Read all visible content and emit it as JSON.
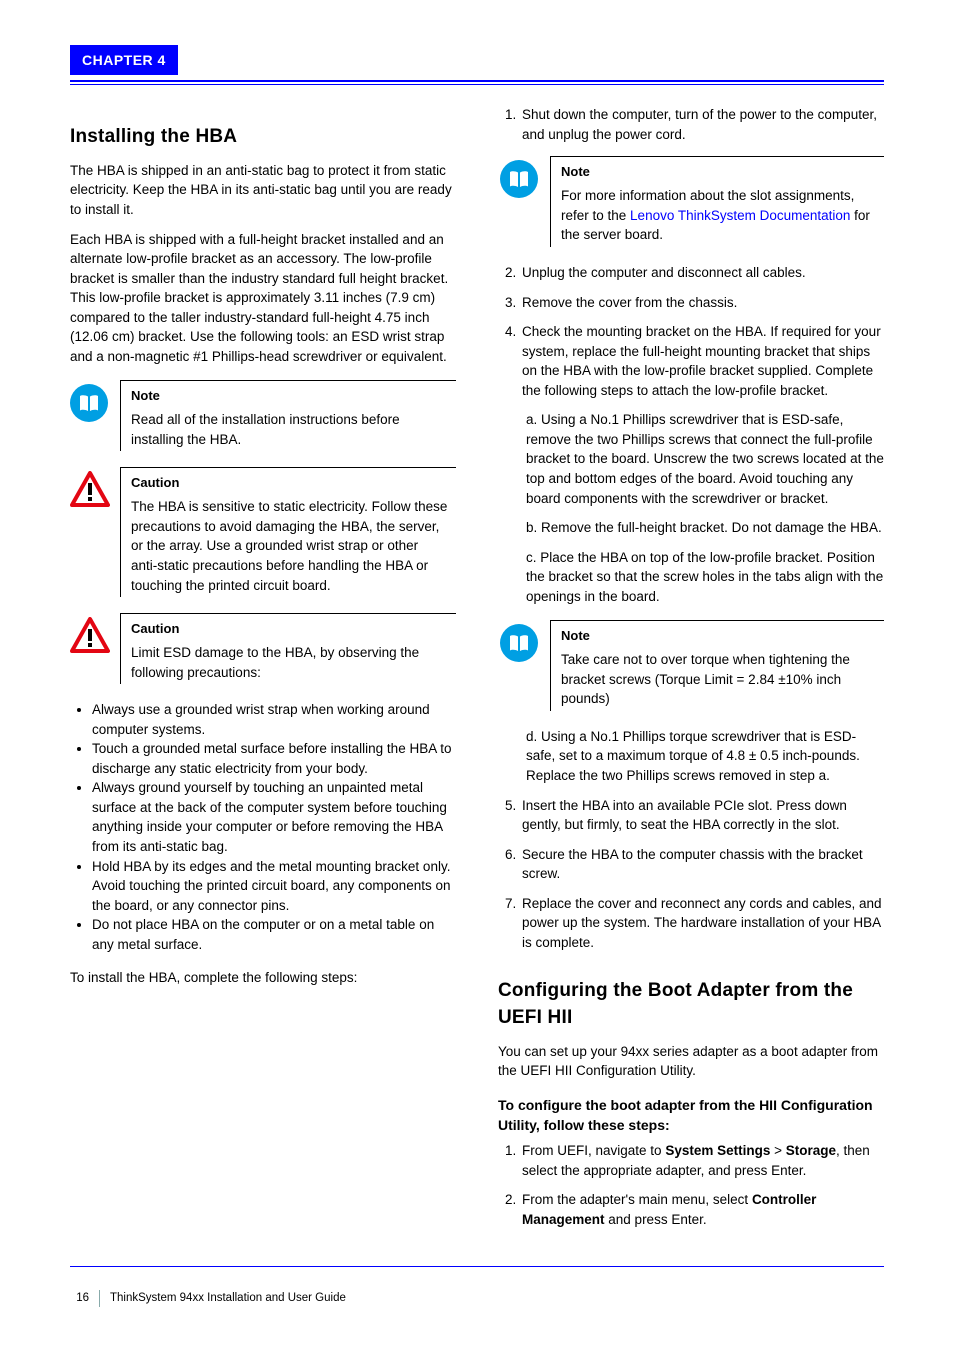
{
  "chapter_badge": "CHAPTER 4",
  "left": {
    "heading1": "Installing the HBA",
    "intro_paras": [
      "The HBA is shipped in an anti-static bag to protect it from static electricity. Keep the HBA in its anti-static bag until you are ready to install it.",
      "Each HBA is shipped with a full-height bracket installed and an alternate low-profile bracket as an accessory. The low-profile bracket is smaller than the industry standard full height bracket. This low-profile bracket is approximately 3.11 inches (7.9 cm) compared to the taller industry-standard full-height 4.75 inch (12.06 cm) bracket. Use the following tools: an ESD wrist strap and a non-magnetic #1 Phillips-head screwdriver or equivalent."
    ],
    "note1": {
      "title": "Note",
      "text": "Read all of the installation instructions before installing the HBA."
    },
    "caution1": {
      "title": "Caution",
      "text": "The HBA is sensitive to static electricity. Follow these precautions to avoid damaging the HBA, the server, or the array. Use a grounded wrist strap or other anti-static precautions before handling the HBA or touching the printed circuit board."
    },
    "caution2": {
      "title": "Caution",
      "text": "Limit ESD damage to the HBA, by observing the following precautions:"
    },
    "bullets": [
      "Always use a grounded wrist strap when working around computer systems.",
      "Touch a grounded metal surface before installing the HBA to discharge any static electricity from your body.",
      "Always ground yourself by touching an unpainted metal surface at the back of the computer system before touching anything inside your computer or before removing the HBA from its anti-static bag.",
      "Hold HBA by its edges and the metal mounting bracket only. Avoid touching the printed circuit board, any components on the board, or any connector pins.",
      "Do not place HBA on the computer or on a metal table on any metal surface."
    ],
    "para_below_bullets": "To install the HBA, complete the following steps:"
  },
  "right": {
    "step1": "Shut down the computer, turn of the power to the computer, and unplug the power cord.",
    "note1": {
      "title": "Note",
      "text_before_link": "For more information about the slot assignments, refer to the ",
      "link_text": "Lenovo ThinkSystem Documentation",
      "text_after_link": " for the server board."
    },
    "step2": "Unplug the computer and disconnect all cables.",
    "step3": "Remove the cover from the chassis.",
    "step4": "Check the mounting bracket on the HBA. If required for your system, replace the full-height mounting bracket that ships on the HBA with the low-profile bracket supplied. Complete the following steps to attach the low-profile bracket.",
    "sub_a": "a. Using a No.1 Phillips screwdriver that is ESD-safe, remove the two Phillips screws that connect the full-profile bracket to the board. Unscrew the two screws located at the top and bottom edges of the board. Avoid touching any board components with the screwdriver or bracket.",
    "sub_b": "b. Remove the full-height bracket. Do not damage the HBA.",
    "sub_c": "c. Place the HBA on top of the low-profile bracket. Position the bracket so that the screw holes in the tabs align with the openings in the board.",
    "note2": {
      "title": "Note",
      "text": "Take care not to over torque when tightening the bracket screws (Torque Limit = 2.84 ±10% inch pounds)"
    },
    "sub_d": "d. Using a No.1 Phillips torque screwdriver that is ESD-safe, set to a maximum torque of 4.8 ± 0.5 inch-pounds. Replace the two Phillips screws removed in step a.",
    "step5": "Insert the HBA into an available PCIe slot. Press down gently, but firmly, to seat the HBA correctly in the slot.",
    "step6": "Secure the HBA to the computer chassis with the bracket screw.",
    "step7": "Replace the cover and reconnect any cords and cables, and power up the system. The hardware installation of your HBA is complete.",
    "heading2": "Configuring the Boot Adapter from the UEFI HII",
    "para_boot": "You can set up your 94xx series adapter as a boot adapter from the UEFI HII Configuration Utility.",
    "subheading": "To configure the boot adapter from the HII Configuration Utility, follow these steps:",
    "boot_step1_pre": "From UEFI, navigate to ",
    "boot_step1_bold1": "System Settings",
    "boot_step1_mid1": " > ",
    "boot_step1_bold2": "Storage",
    "boot_step1_mid2": ", then select the appropriate adapter, and press Enter.",
    "boot_step2_pre": "From the adapter's main menu, select ",
    "boot_step2_bold": "Controller Management",
    "boot_step2_end": " and press Enter."
  },
  "footer": {
    "page": "16",
    "text": "ThinkSystem 94xx Installation and User Guide"
  }
}
